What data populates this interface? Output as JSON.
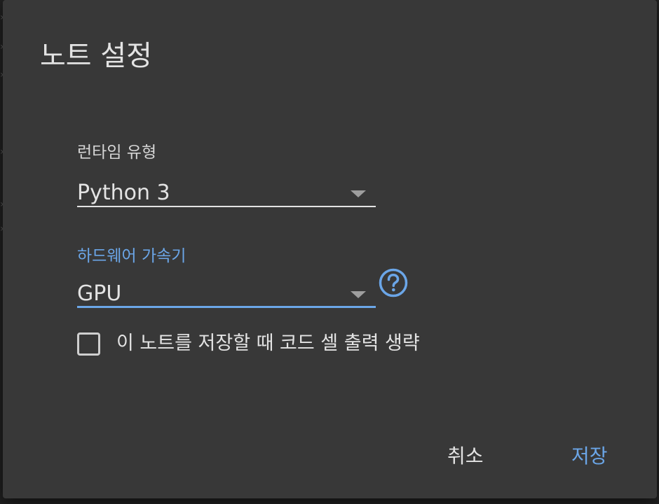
{
  "dialog": {
    "title": "노트 설정",
    "runtime": {
      "label": "런타임 유형",
      "value": "Python 3"
    },
    "accelerator": {
      "label": "하드웨어 가속기",
      "value": "GPU",
      "help_icon": "help-circle-icon"
    },
    "omit_output": {
      "label": "이 노트를 저장할 때 코드 셀 출력 생략",
      "checked": false
    },
    "actions": {
      "cancel": "취소",
      "save": "저장"
    }
  },
  "colors": {
    "dialog_bg": "#383838",
    "accent": "#6ba6e8",
    "text": "#e3e3e3"
  }
}
